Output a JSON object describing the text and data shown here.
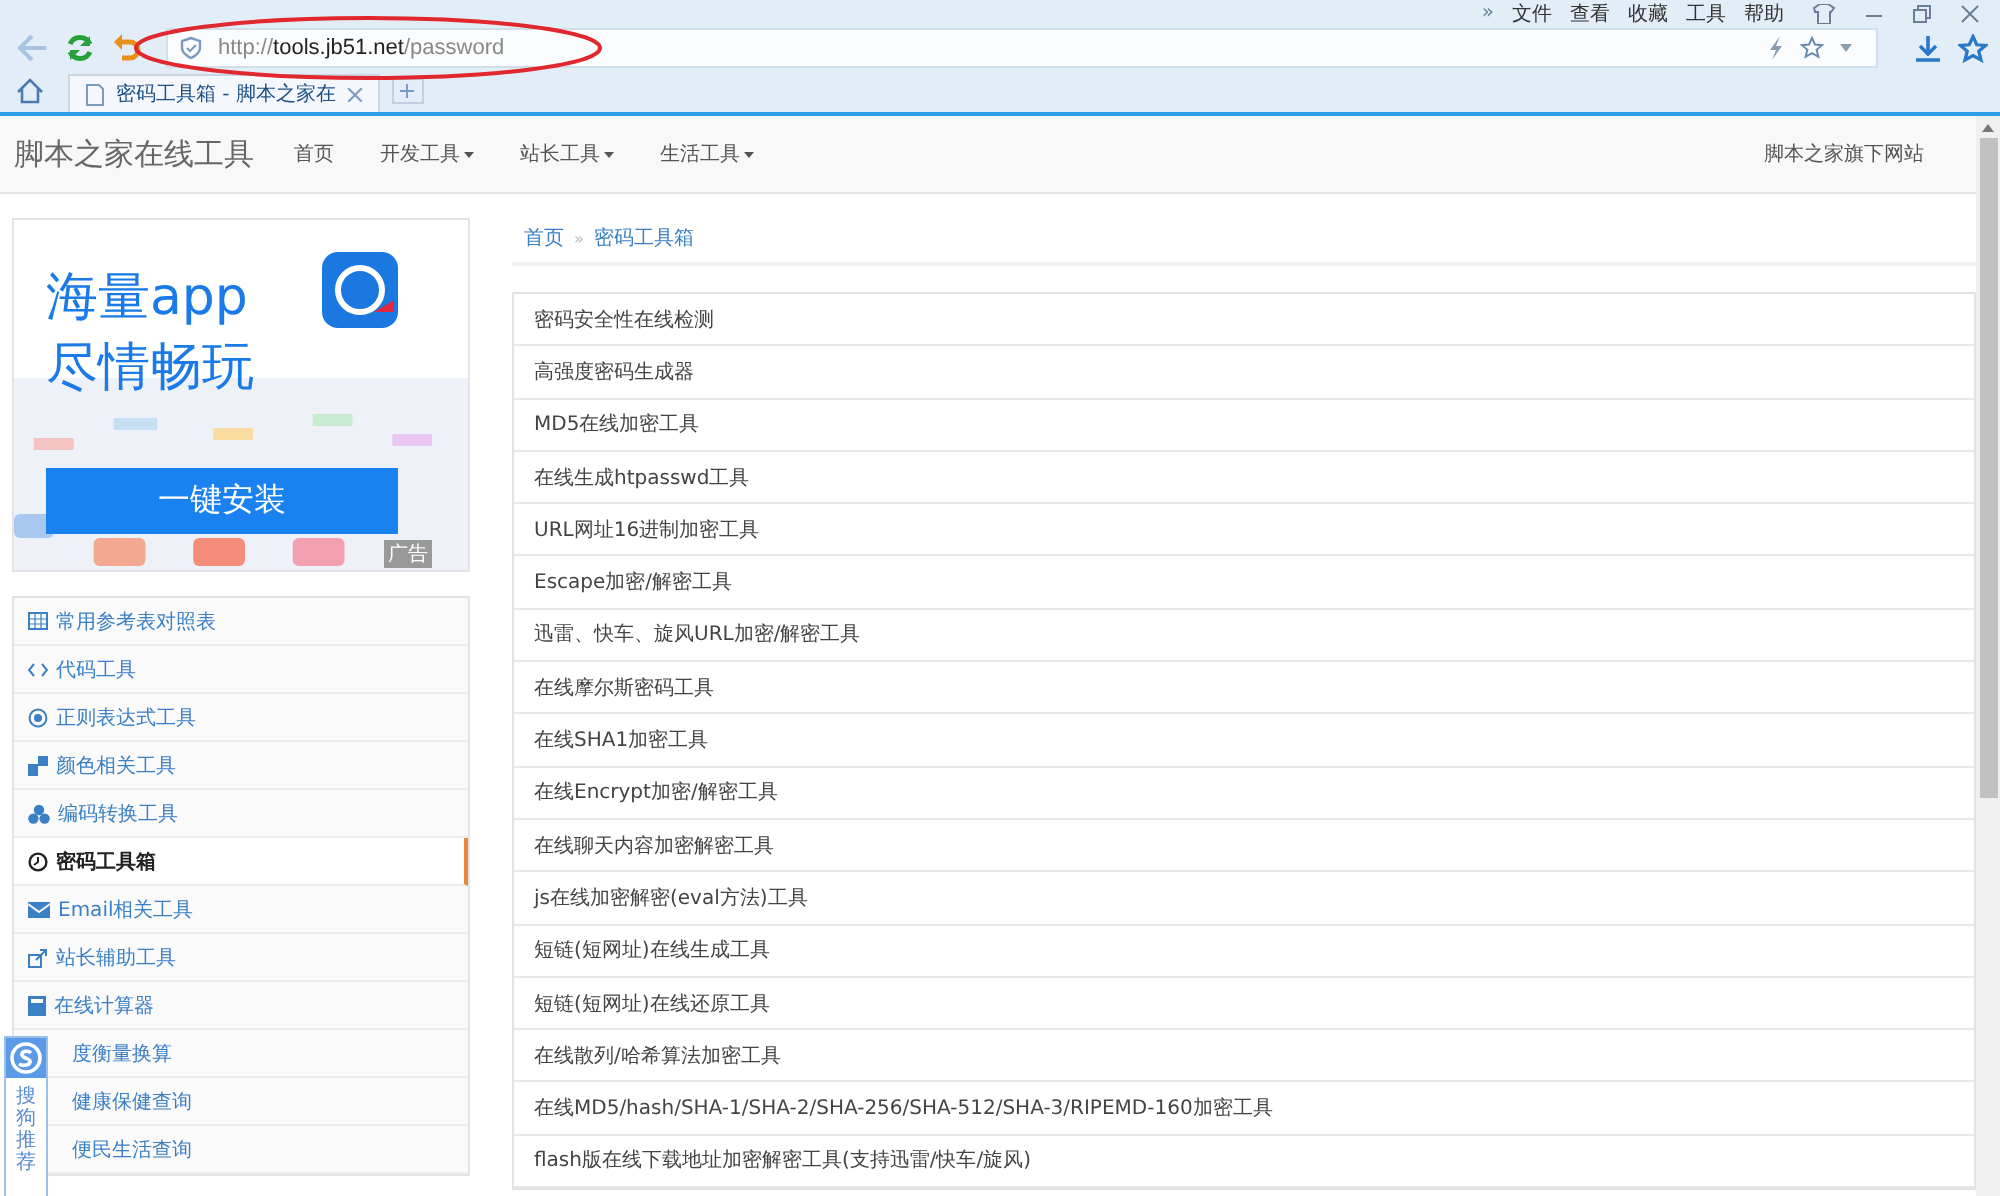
{
  "browser": {
    "more": "»",
    "menu": [
      "文件",
      "查看",
      "收藏",
      "工具",
      "帮助"
    ],
    "url_parts": [
      "http://",
      "tools.jb51.net",
      "/password"
    ],
    "tabs": [
      {
        "label": "密码工具箱 - 脚本之家在",
        "selected": true
      }
    ]
  },
  "navbar": {
    "brand": "脚本之家在线工具",
    "links": [
      {
        "label": "首页",
        "has_menu": false
      },
      {
        "label": "开发工具",
        "has_menu": true
      },
      {
        "label": "站长工具",
        "has_menu": true
      },
      {
        "label": "生活工具",
        "has_menu": true
      }
    ],
    "right_link": "脚本之家旗下网站"
  },
  "ad": {
    "headline": [
      "海量app",
      "尽情畅玩"
    ],
    "button": "一键安装",
    "label": "广告"
  },
  "sidebar": {
    "items": [
      {
        "label": "常用参考表对照表",
        "selected": false
      },
      {
        "label": "代码工具",
        "selected": false
      },
      {
        "label": "正则表达式工具",
        "selected": false
      },
      {
        "label": "颜色相关工具",
        "selected": false
      },
      {
        "label": "编码转换工具",
        "selected": false
      },
      {
        "label": "密码工具箱",
        "selected": true
      },
      {
        "label": "Email相关工具",
        "selected": false
      },
      {
        "label": "站长辅助工具",
        "selected": false
      },
      {
        "label": "在线计算器",
        "selected": false
      },
      {
        "label": "度衡量换算",
        "selected": false
      },
      {
        "label": "健康保健查询",
        "selected": false
      },
      {
        "label": "便民生活查询",
        "selected": false
      }
    ]
  },
  "widget": {
    "text": "搜狗推荐"
  },
  "breadcrumb": {
    "separator": "»",
    "items": [
      "首页",
      "密码工具箱"
    ]
  },
  "tools": [
    "密码安全性在线检测",
    "高强度密码生成器",
    "MD5在线加密工具",
    "在线生成htpasswd工具",
    "URL网址16进制加密工具",
    "Escape加密/解密工具",
    "迅雷、快车、旋风URL加密/解密工具",
    "在线摩尔斯密码工具",
    "在线SHA1加密工具",
    "在线Encrypt加密/解密工具",
    "在线聊天内容加密解密工具",
    "js在线加密解密(eval方法)工具",
    "短链(短网址)在线生成工具",
    "短链(短网址)在线还原工具",
    "在线散列/哈希算法加密工具",
    "在线MD5/hash/SHA-1/SHA-2/SHA-256/SHA-512/SHA-3/RIPEMD-160加密工具",
    "flash版在线下载地址加密解密工具(支持迅雷/快车/旋风)"
  ]
}
